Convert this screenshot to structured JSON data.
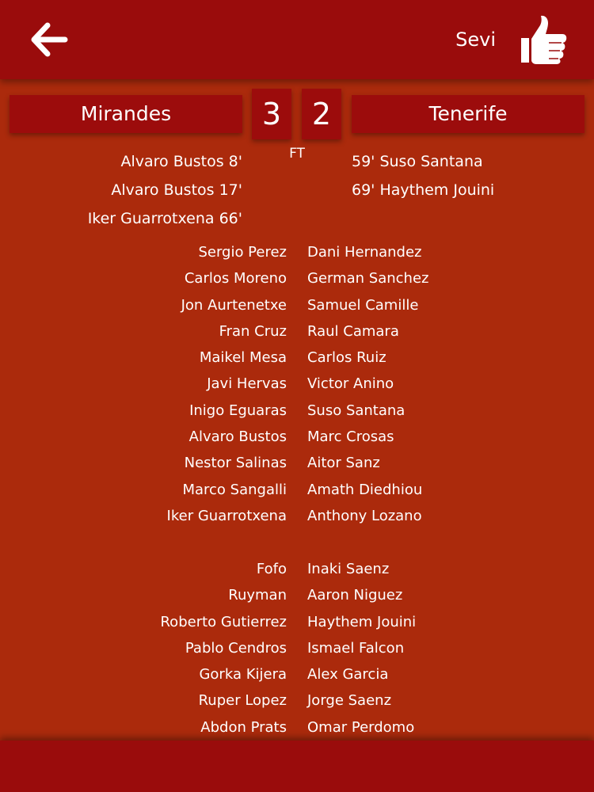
{
  "header": {
    "back_icon": "arrow-left-icon",
    "user_name": "Sevi",
    "like_icon": "thumbs-up-icon"
  },
  "match": {
    "home_team": "Mirandes",
    "away_team": "Tenerife",
    "home_score": "3",
    "away_score": "2",
    "status": "FT",
    "home_goals": [
      "Alvaro Bustos 8'",
      "Alvaro Bustos 17'",
      "Iker Guarrotxena 66'"
    ],
    "away_goals": [
      "59' Suso Santana",
      "69' Haythem Jouini"
    ]
  },
  "lineups": {
    "home_starters": [
      "Sergio Perez",
      "Carlos Moreno",
      "Jon Aurtenetxe",
      "Fran Cruz",
      "Maikel Mesa",
      "Javi Hervas",
      "Inigo Eguaras",
      "Alvaro Bustos",
      "Nestor Salinas",
      "Marco Sangalli",
      "Iker Guarrotxena"
    ],
    "away_starters": [
      "Dani Hernandez",
      "German Sanchez",
      "Samuel Camille",
      "Raul Camara",
      "Carlos Ruiz",
      "Victor Anino",
      "Suso Santana",
      "Marc Crosas",
      "Aitor Sanz",
      "Amath Diedhiou",
      "Anthony Lozano"
    ],
    "home_bench": [
      "Fofo",
      "Ruyman",
      "Roberto Gutierrez",
      "Pablo Cendros",
      "Gorka Kijera",
      "Ruper Lopez",
      "Abdon Prats"
    ],
    "away_bench": [
      "Inaki Saenz",
      "Aaron Niguez",
      "Haythem Jouini",
      "Ismael Falcon",
      "Alex Garcia",
      "Jorge Saenz",
      "Omar Perdomo"
    ]
  }
}
